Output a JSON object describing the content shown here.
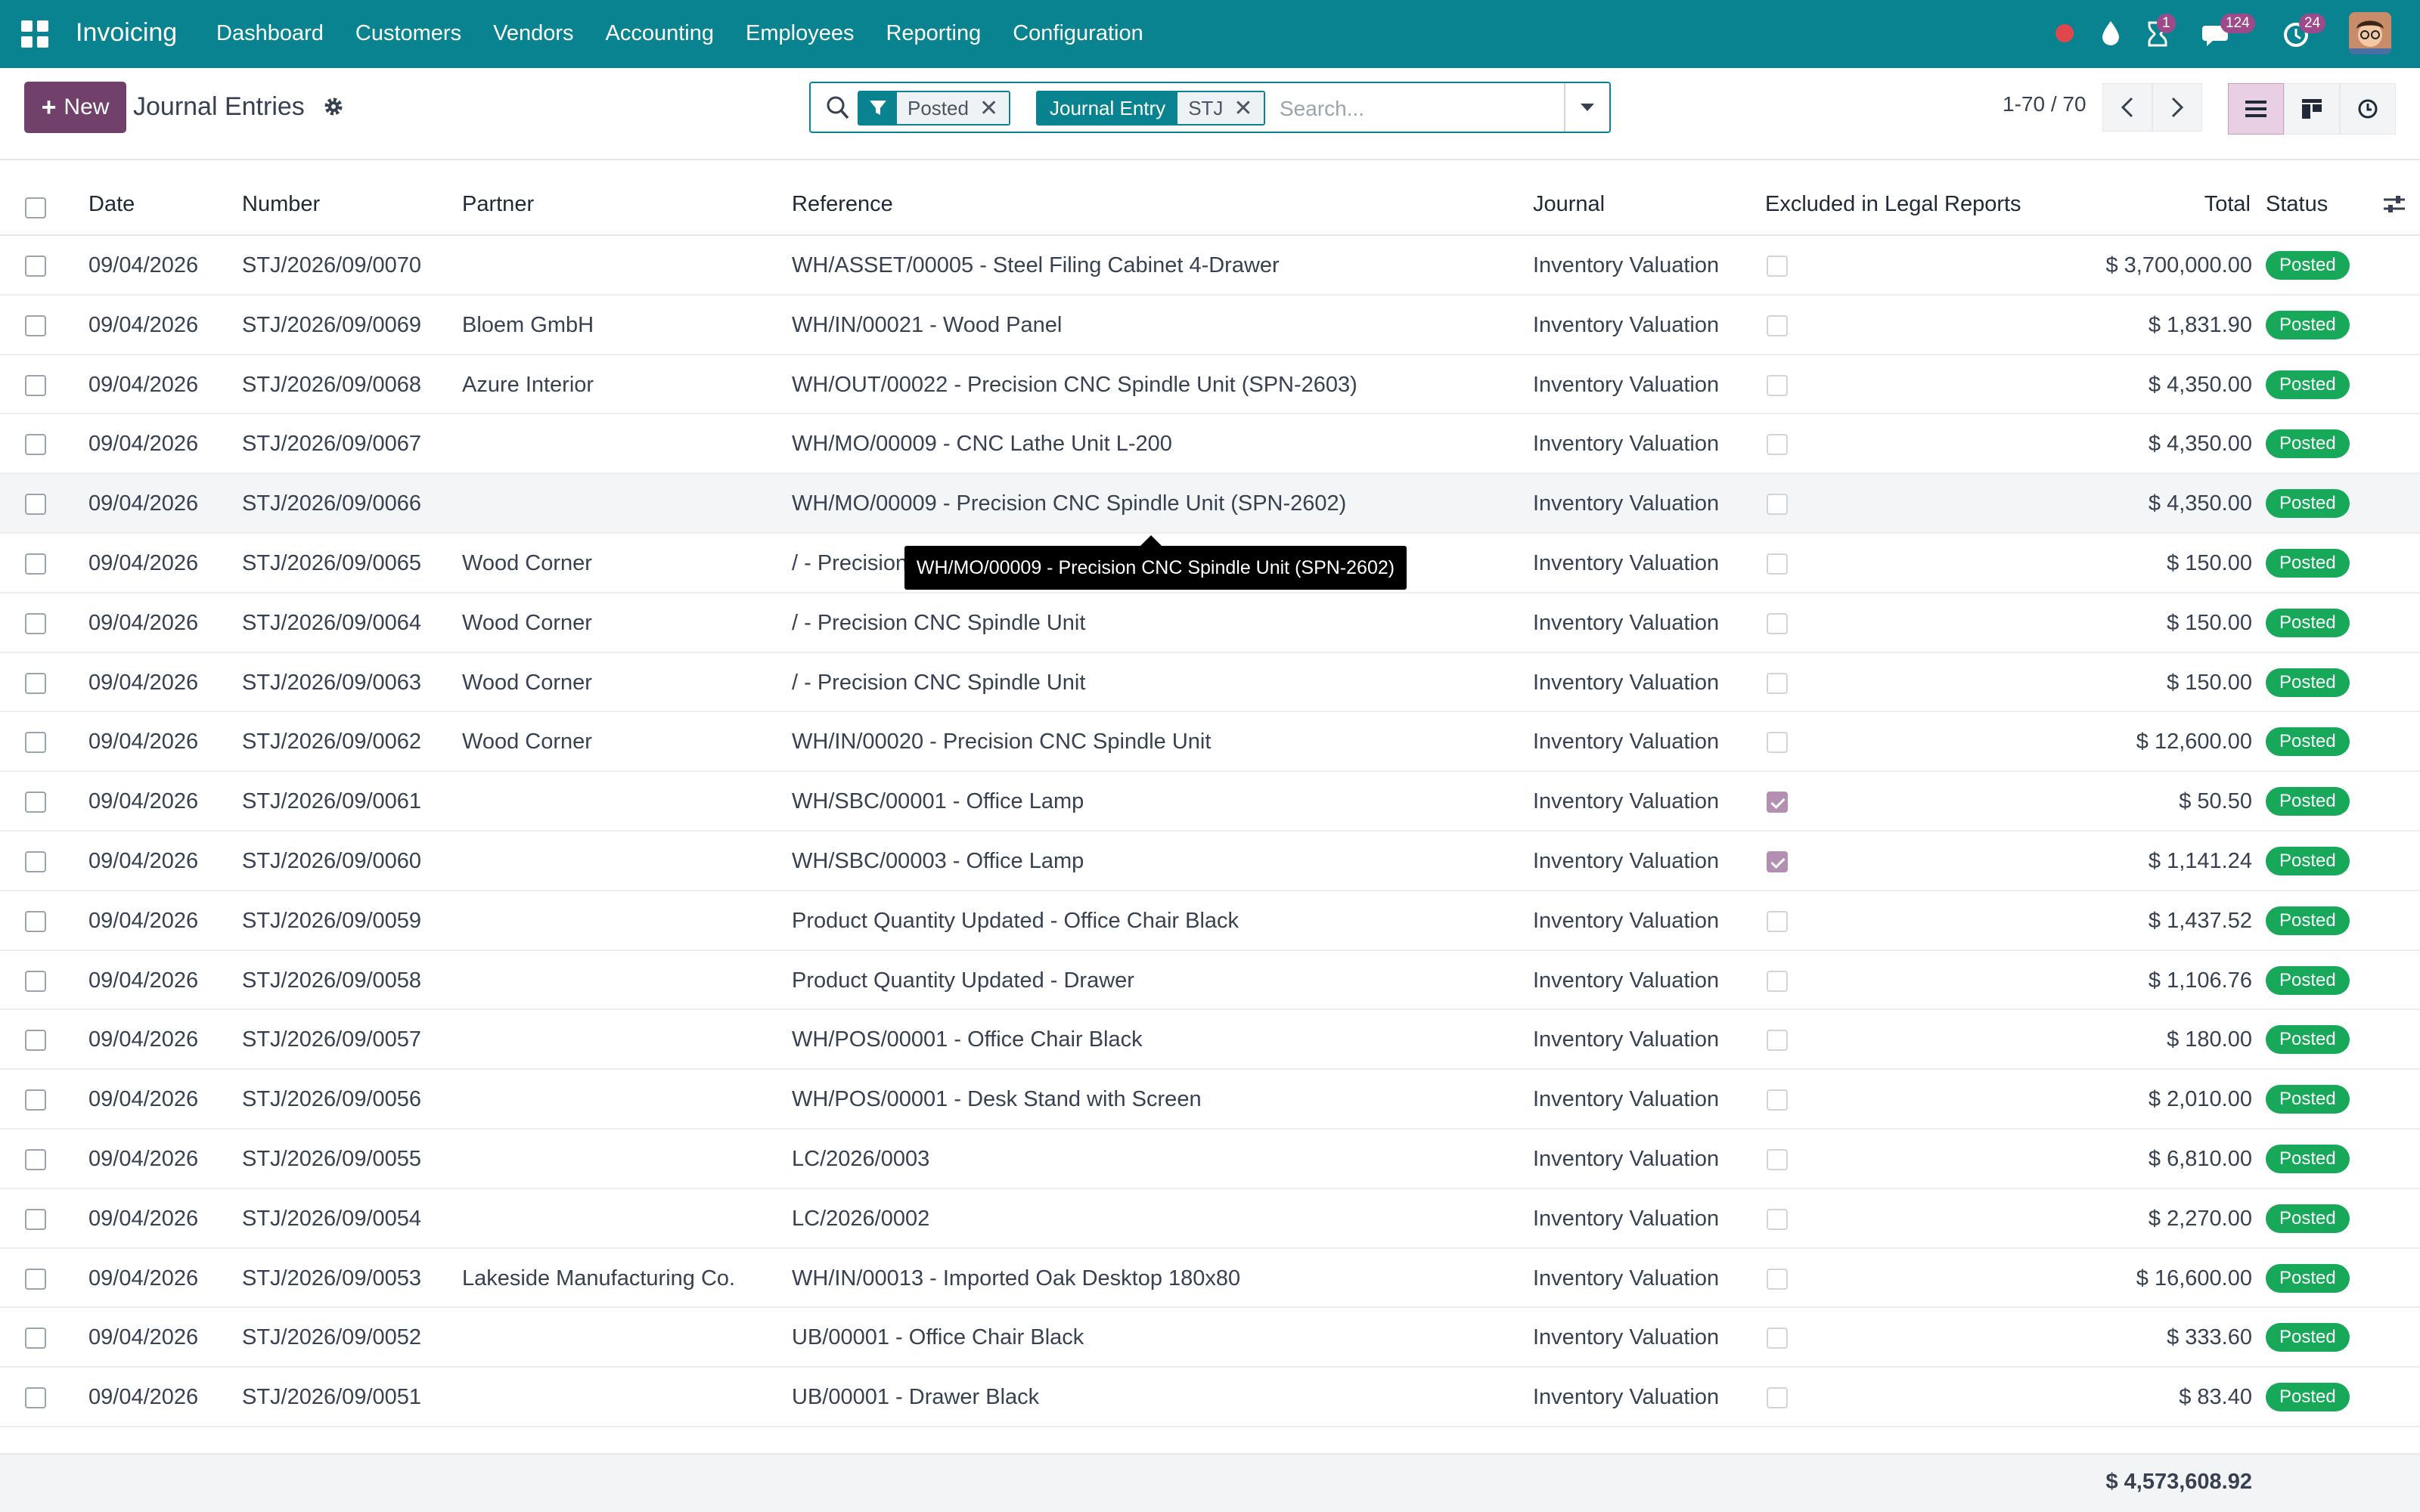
{
  "navbar": {
    "brand": "Invoicing",
    "menu": [
      "Dashboard",
      "Customers",
      "Vendors",
      "Accounting",
      "Employees",
      "Reporting",
      "Configuration"
    ],
    "badges": {
      "activity": "1",
      "messages": "124",
      "updates": "24"
    },
    "colors": {
      "bar": "#0a8391",
      "badge": "#9c4a8a"
    }
  },
  "control": {
    "new_label": "New",
    "title": "Journal Entries",
    "search": {
      "facet_filter": "Posted",
      "facet_group_label": "Journal Entry",
      "facet_group_value": "STJ",
      "placeholder": "Search..."
    },
    "pager": "1-70 / 70"
  },
  "table": {
    "headers": {
      "date": "Date",
      "number": "Number",
      "partner": "Partner",
      "reference": "Reference",
      "journal": "Journal",
      "excluded": "Excluded in Legal Reports",
      "total": "Total",
      "status": "Status"
    },
    "rows": [
      {
        "date": "09/04/2026",
        "number": "STJ/2026/09/0070",
        "partner": "",
        "reference": "WH/ASSET/00005 - Steel Filing Cabinet 4-Drawer",
        "journal": "Inventory Valuation",
        "excluded": false,
        "total": "$ 3,700,000.00",
        "status": "Posted"
      },
      {
        "date": "09/04/2026",
        "number": "STJ/2026/09/0069",
        "partner": "Bloem GmbH",
        "reference": "WH/IN/00021 - Wood Panel",
        "journal": "Inventory Valuation",
        "excluded": false,
        "total": "$ 1,831.90",
        "status": "Posted"
      },
      {
        "date": "09/04/2026",
        "number": "STJ/2026/09/0068",
        "partner": "Azure Interior",
        "reference": "WH/OUT/00022 - Precision CNC Spindle Unit (SPN-2603)",
        "journal": "Inventory Valuation",
        "excluded": false,
        "total": "$ 4,350.00",
        "status": "Posted"
      },
      {
        "date": "09/04/2026",
        "number": "STJ/2026/09/0067",
        "partner": "",
        "reference": "WH/MO/00009 - CNC Lathe Unit L-200",
        "journal": "Inventory Valuation",
        "excluded": false,
        "total": "$ 4,350.00",
        "status": "Posted"
      },
      {
        "date": "09/04/2026",
        "number": "STJ/2026/09/0066",
        "partner": "",
        "reference": "WH/MO/00009 - Precision CNC Spindle Unit (SPN-2602)",
        "journal": "Inventory Valuation",
        "excluded": false,
        "total": "$ 4,350.00",
        "status": "Posted"
      },
      {
        "date": "09/04/2026",
        "number": "STJ/2026/09/0065",
        "partner": "Wood Corner",
        "reference": "/ - Precision CNC Spindle Unit",
        "journal": "Inventory Valuation",
        "excluded": false,
        "total": "$ 150.00",
        "status": "Posted"
      },
      {
        "date": "09/04/2026",
        "number": "STJ/2026/09/0064",
        "partner": "Wood Corner",
        "reference": "/ - Precision CNC Spindle Unit",
        "journal": "Inventory Valuation",
        "excluded": false,
        "total": "$ 150.00",
        "status": "Posted"
      },
      {
        "date": "09/04/2026",
        "number": "STJ/2026/09/0063",
        "partner": "Wood Corner",
        "reference": "/ - Precision CNC Spindle Unit",
        "journal": "Inventory Valuation",
        "excluded": false,
        "total": "$ 150.00",
        "status": "Posted"
      },
      {
        "date": "09/04/2026",
        "number": "STJ/2026/09/0062",
        "partner": "Wood Corner",
        "reference": "WH/IN/00020 - Precision CNC Spindle Unit",
        "journal": "Inventory Valuation",
        "excluded": false,
        "total": "$ 12,600.00",
        "status": "Posted"
      },
      {
        "date": "09/04/2026",
        "number": "STJ/2026/09/0061",
        "partner": "",
        "reference": "WH/SBC/00001 - Office Lamp",
        "journal": "Inventory Valuation",
        "excluded": true,
        "total": "$ 50.50",
        "status": "Posted"
      },
      {
        "date": "09/04/2026",
        "number": "STJ/2026/09/0060",
        "partner": "",
        "reference": "WH/SBC/00003 - Office Lamp",
        "journal": "Inventory Valuation",
        "excluded": true,
        "total": "$ 1,141.24",
        "status": "Posted"
      },
      {
        "date": "09/04/2026",
        "number": "STJ/2026/09/0059",
        "partner": "",
        "reference": "Product Quantity Updated - Office Chair Black",
        "journal": "Inventory Valuation",
        "excluded": false,
        "total": "$ 1,437.52",
        "status": "Posted"
      },
      {
        "date": "09/04/2026",
        "number": "STJ/2026/09/0058",
        "partner": "",
        "reference": "Product Quantity Updated - Drawer",
        "journal": "Inventory Valuation",
        "excluded": false,
        "total": "$ 1,106.76",
        "status": "Posted"
      },
      {
        "date": "09/04/2026",
        "number": "STJ/2026/09/0057",
        "partner": "",
        "reference": "WH/POS/00001 - Office Chair Black",
        "journal": "Inventory Valuation",
        "excluded": false,
        "total": "$ 180.00",
        "status": "Posted"
      },
      {
        "date": "09/04/2026",
        "number": "STJ/2026/09/0056",
        "partner": "",
        "reference": "WH/POS/00001 - Desk Stand with Screen",
        "journal": "Inventory Valuation",
        "excluded": false,
        "total": "$ 2,010.00",
        "status": "Posted"
      },
      {
        "date": "09/04/2026",
        "number": "STJ/2026/09/0055",
        "partner": "",
        "reference": "LC/2026/0003",
        "journal": "Inventory Valuation",
        "excluded": false,
        "total": "$ 6,810.00",
        "status": "Posted"
      },
      {
        "date": "09/04/2026",
        "number": "STJ/2026/09/0054",
        "partner": "",
        "reference": "LC/2026/0002",
        "journal": "Inventory Valuation",
        "excluded": false,
        "total": "$ 2,270.00",
        "status": "Posted"
      },
      {
        "date": "09/04/2026",
        "number": "STJ/2026/09/0053",
        "partner": "Lakeside Manufacturing Co.",
        "reference": "WH/IN/00013 - Imported Oak Desktop 180x80",
        "journal": "Inventory Valuation",
        "excluded": false,
        "total": "$ 16,600.00",
        "status": "Posted"
      },
      {
        "date": "09/04/2026",
        "number": "STJ/2026/09/0052",
        "partner": "",
        "reference": "UB/00001 - Office Chair Black",
        "journal": "Inventory Valuation",
        "excluded": false,
        "total": "$ 333.60",
        "status": "Posted"
      },
      {
        "date": "09/04/2026",
        "number": "STJ/2026/09/0051",
        "partner": "",
        "reference": "UB/00001 - Drawer Black",
        "journal": "Inventory Valuation",
        "excluded": false,
        "total": "$ 83.40",
        "status": "Posted"
      }
    ],
    "hover_row": 4,
    "status_color": "#17a85a"
  },
  "tooltip": "WH/MO/00009 - Precision CNC Spindle Unit (SPN-2602)",
  "footer": {
    "grand_total": "$ 4,573,608.92"
  }
}
